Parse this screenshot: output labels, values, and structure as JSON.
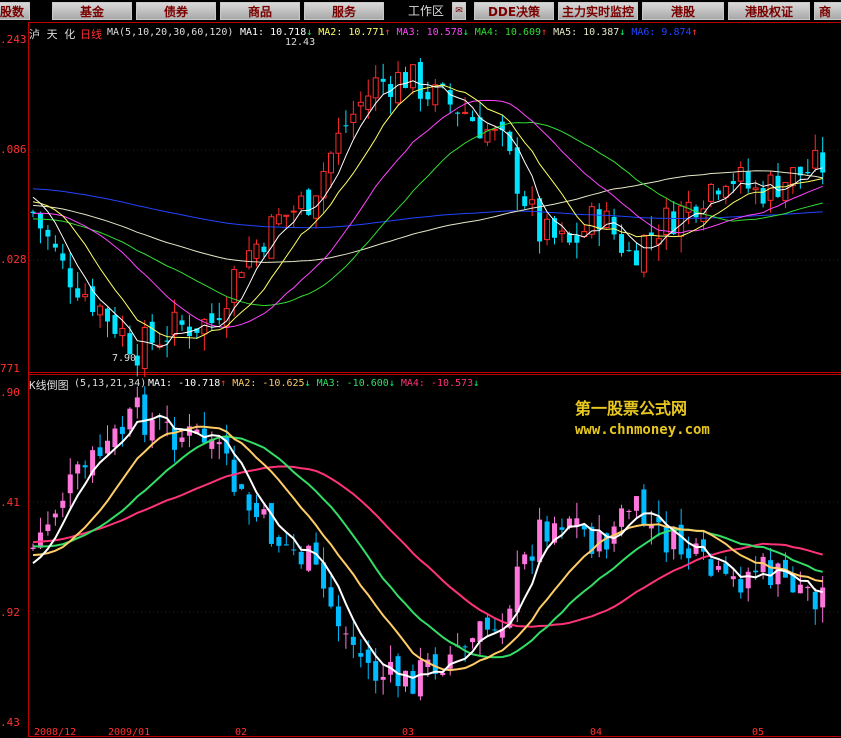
{
  "toolbar": {
    "items": [
      "股数",
      "基金",
      "债券",
      "商品",
      "服务",
      "工作区",
      "DDE决策",
      "主力实时监控",
      "港股",
      "港股权证",
      "商"
    ]
  },
  "colors": {
    "up": "#ff2a2a",
    "down": "#00e4ff",
    "ma5": "#ffffff",
    "ma10": "#ffff66",
    "ma20": "#ff44ff",
    "ma30": "#33dd33",
    "ma60": "#e6e6c8",
    "ma120": "#2244ff",
    "k1": "#ffffff",
    "k2": "#ffcc66",
    "k3": "#33dd66",
    "k4": "#ff3377",
    "kup": "#ff77dd",
    "kdown": "#00bbff"
  },
  "upper": {
    "title_a": "泸 天 化",
    "title_b": "日线",
    "ma_label": "MA(5,10,20,30,60,120)",
    "ma_values": [
      {
        "name": "MA1",
        "value": "10.718",
        "arrow": "↓"
      },
      {
        "name": "MA2",
        "value": "10.771",
        "arrow": "↑"
      },
      {
        "name": "MA3",
        "value": "10.578",
        "arrow": "↓"
      },
      {
        "name": "MA4",
        "value": "10.609",
        "arrow": "↑"
      },
      {
        "name": "MA5",
        "value": "10.387",
        "arrow": "↓"
      },
      {
        "name": "MA6",
        "value": "9.874",
        "arrow": "↑"
      }
    ],
    "y_labels": [
      ".243",
      ".086",
      ".028",
      "771"
    ],
    "high_label": "12.43",
    "low_label": "7.90"
  },
  "lower": {
    "title": "K线倒图",
    "ma_label": "(5,13,21,34)",
    "ma_values": [
      {
        "name": "MA1",
        "value": "-10.718",
        "arrow": "↑"
      },
      {
        "name": "MA2",
        "value": "-10.625",
        "arrow": "↓"
      },
      {
        "name": "MA3",
        "value": "-10.600",
        "arrow": "↓"
      },
      {
        "name": "MA4",
        "value": "-10.573",
        "arrow": "↓"
      }
    ],
    "y_labels": [
      ".90",
      ".41",
      ".92",
      ".43"
    ]
  },
  "watermark": {
    "line1": "第一股票公式网",
    "line2": "www.chnmoney.com"
  },
  "x_labels": [
    "2008/12",
    "2009/01",
    "02",
    "03",
    "04",
    "05"
  ]
}
